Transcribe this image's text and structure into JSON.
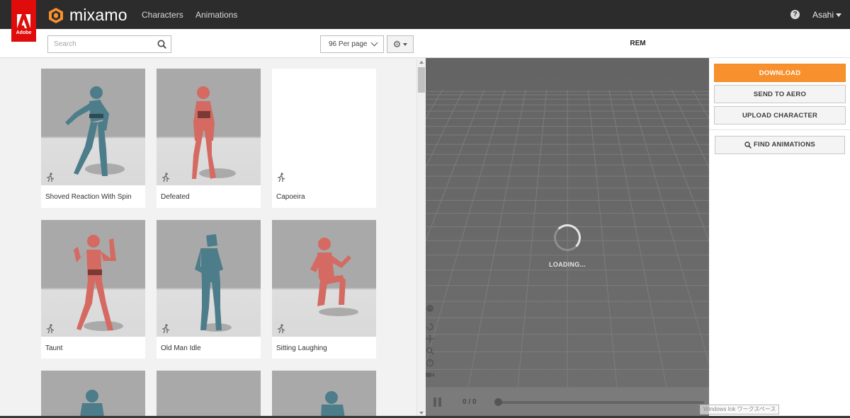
{
  "brand": {
    "adobe_label": "Adobe",
    "name": "mixamo"
  },
  "nav": {
    "characters": "Characters",
    "animations": "Animations"
  },
  "user": {
    "name": "Asahi"
  },
  "toolbar": {
    "search_placeholder": "Search",
    "per_page": "96 Per page"
  },
  "grid": {
    "cards": [
      {
        "label": "Shoved Reaction With Spin"
      },
      {
        "label": "Defeated"
      },
      {
        "label": "Capoeira"
      },
      {
        "label": "Taunt"
      },
      {
        "label": "Old Man Idle"
      },
      {
        "label": "Sitting Laughing"
      }
    ]
  },
  "viewer": {
    "title": "REM",
    "loading": "LOADING...",
    "counter": "0 / 0"
  },
  "actions": {
    "download": "DOWNLOAD",
    "send_to_aero": "SEND TO AERO",
    "upload_character": "UPLOAD CHARACTER",
    "find_animations": "FIND ANIMATIONS"
  },
  "watermark": "Windows Ink ワークスペース",
  "colors": {
    "topbar": "#2c2c2c",
    "adobe_red": "#e00b0b",
    "accent_orange": "#f7902d",
    "figure_teal": "#4d7d8a",
    "figure_red": "#d46a62",
    "viewport_gray": "#6a6a6a"
  }
}
